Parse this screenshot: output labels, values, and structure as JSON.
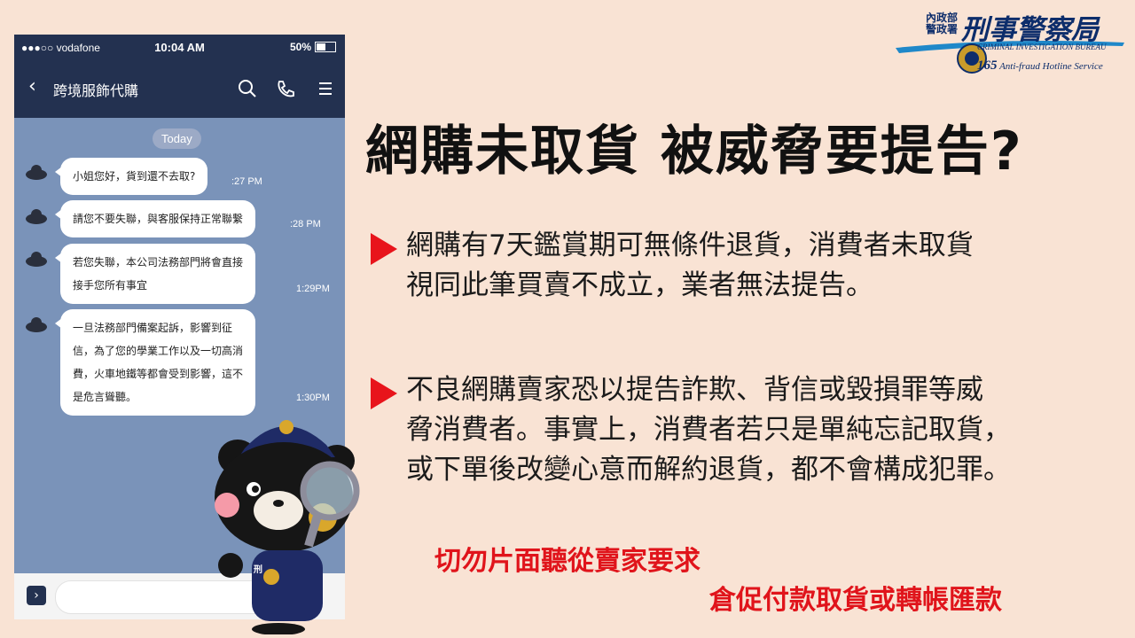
{
  "phone": {
    "status": {
      "carrier": "●●●○○ vodafone",
      "time": "10:04 AM",
      "battery": "50%",
      "battery_level": 0.5
    },
    "nav": {
      "title": "跨境服飾代購",
      "back_icon": "chevron-left-icon",
      "icons": [
        "search-icon",
        "phone-icon",
        "menu-icon"
      ]
    },
    "date_badge": "Today",
    "messages": [
      {
        "lines": [
          "小姐您好，貨到還不去取?"
        ],
        "time": ":27 PM"
      },
      {
        "lines": [
          "請您不要失聯，與客服保持正常聯繫"
        ],
        "time": ":28 PM"
      },
      {
        "lines": [
          "若您失聯，本公司法務部門將會直接",
          "接手您所有事宜"
        ],
        "time": "1:29PM"
      },
      {
        "lines": [
          "一旦法務部門備案起訴，影響到征",
          "信，為了您的學業工作以及一切高消",
          "費，火車地鐵等都會受到影響，這不",
          "是危言聳聽。"
        ],
        "time": "1:30PM"
      }
    ]
  },
  "heading": "網購未取貨 被威脅要提告?",
  "bullets": [
    {
      "lines": [
        "網購有7天鑑賞期可無條件退貨，消費者未取貨",
        "視同此筆買賣不成立，業者無法提告。"
      ]
    },
    {
      "lines": [
        "不良網購賣家恐以提告詐欺、背信或毀損罪等威",
        "脅消費者。事實上，消費者若只是單純忘記取貨，",
        "或下單後改變心意而解約退貨，都不會構成犯罪。"
      ]
    }
  ],
  "warning": {
    "line1": "切勿片面聽從賣家要求",
    "line2": "倉促付款取貨或轉帳匯款"
  },
  "logo": {
    "agency_small_1": "內政部",
    "agency_small_2": "警政署",
    "agency": "刑事警察局",
    "english": "CRIMINAL INVESTIGATION BUREAU",
    "hotline_number": "165",
    "hotline": "Anti-fraud Hotline Service"
  },
  "mascot_badge": "刑\n警",
  "colors": {
    "accent": "#e8141b",
    "navy": "#233150",
    "chat_bg": "#7a93b9",
    "background": "#f9e3d4"
  }
}
